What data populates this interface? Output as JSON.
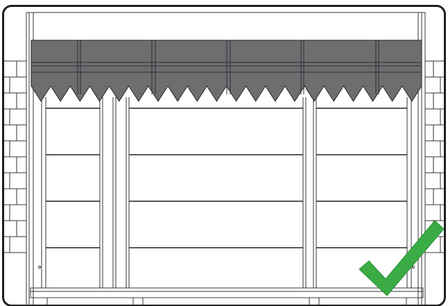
{
  "drawing": {
    "subject": "window-with-valance-awning",
    "brick_courses_each_side": 12,
    "valance_panels": 6,
    "valance_teeth": 20,
    "pane_rows": 4,
    "pane_columns": 3
  },
  "status": {
    "icon": "checkmark-icon",
    "color": "#3bab46"
  },
  "colors": {
    "frame_border": "#1e1e1e",
    "awning_fill": "#6e6e6e",
    "line": "#222222"
  }
}
